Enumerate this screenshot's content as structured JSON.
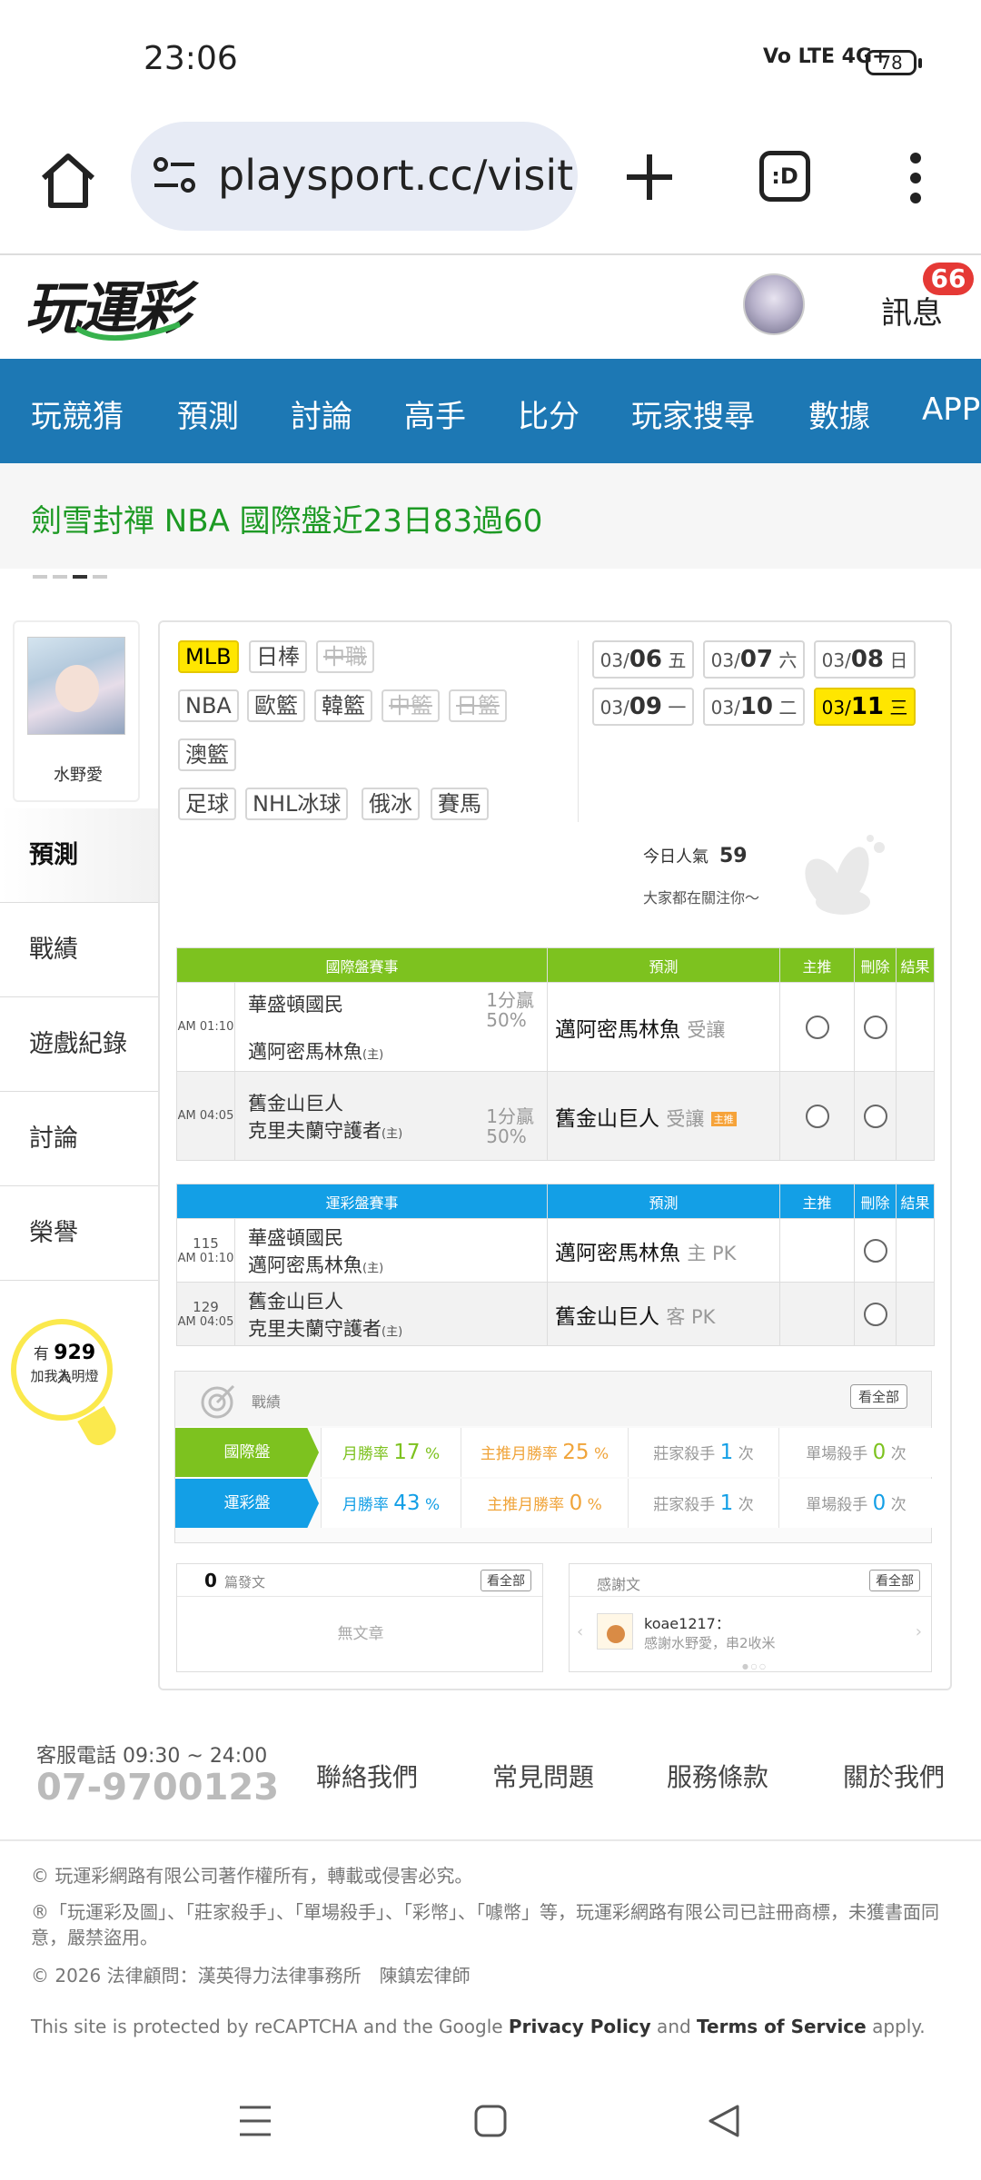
{
  "status_bar": {
    "time": "23:06",
    "network": "Vo LTE 4G+",
    "battery": "78"
  },
  "browser": {
    "url": "playsport.cc/visit",
    "tab_label": ":D"
  },
  "site": {
    "logo": "玩運彩",
    "messages_label": "訊息",
    "messages_count": "66",
    "nav": [
      "玩競猜",
      "預測",
      "討論",
      "高手",
      "比分",
      "玩家搜尋",
      "數據",
      "APP"
    ],
    "promo": "劍雪封禪 NBA 國際盤近23日83過60"
  },
  "profile": {
    "name": "水野愛",
    "menu": [
      "預測",
      "戰績",
      "遊戲紀錄",
      "討論",
      "榮譽"
    ],
    "fans_prefix": "有",
    "fans_count": "929",
    "fans_suffix": "人",
    "fans_cta": "加我為明燈"
  },
  "leagues": {
    "row1": [
      "MLB",
      "日棒",
      "中職"
    ],
    "row2": [
      "NBA",
      "歐籃",
      "韓籃",
      "中籃",
      "日籃"
    ],
    "row3": [
      "澳籃"
    ],
    "row4": [
      "足球",
      "NHL冰球",
      "俄冰",
      "賽馬"
    ]
  },
  "dates": [
    {
      "md": "03/",
      "day": "06",
      "wd": "五"
    },
    {
      "md": "03/",
      "day": "07",
      "wd": "六"
    },
    {
      "md": "03/",
      "day": "08",
      "wd": "日"
    },
    {
      "md": "03/",
      "day": "09",
      "wd": "一"
    },
    {
      "md": "03/",
      "day": "10",
      "wd": "二"
    },
    {
      "md": "03/",
      "day": "11",
      "wd": "三"
    }
  ],
  "popularity": {
    "label": "今日人氣",
    "value": "59",
    "note": "大家都在關注你～"
  },
  "intl_table": {
    "headers": [
      "國際盤賽事",
      "預測",
      "主推",
      "刪除",
      "結果"
    ],
    "rows": [
      {
        "time": "AM 01:10",
        "team1": "華盛頓國民",
        "team2": "邁阿密馬林魚",
        "home": "(主)",
        "odds1": "1分贏",
        "odds2": "50%",
        "pick": "邁阿密馬林魚",
        "pick_type": "受讓"
      },
      {
        "time": "AM 04:05",
        "team1": "舊金山巨人",
        "team2": "克里夫蘭守護者",
        "home": "(主)",
        "odds1": "1分贏",
        "odds2": "50%",
        "pick": "舊金山巨人",
        "pick_type": "受讓",
        "tag": "主推"
      }
    ]
  },
  "lottery_table": {
    "headers": [
      "運彩盤賽事",
      "預測",
      "主推",
      "刪除",
      "結果"
    ],
    "rows": [
      {
        "no": "115",
        "time": "AM 01:10",
        "team1": "華盛頓國民",
        "team2": "邁阿密馬林魚",
        "home": "(主)",
        "pick": "邁阿密馬林魚",
        "pick_type": "主 PK"
      },
      {
        "no": "129",
        "time": "AM 04:05",
        "team1": "舊金山巨人",
        "team2": "克里夫蘭守護者",
        "home": "(主)",
        "pick": "舊金山巨人",
        "pick_type": "客 PK"
      }
    ]
  },
  "record": {
    "title": "戰績",
    "view_all": "看全部",
    "rows": [
      {
        "label": "國際盤",
        "color": "#7dc21f",
        "win_label": "月勝率",
        "win": "17",
        "main_label": "主推月勝率",
        "main": "25",
        "banker_label": "莊家殺手",
        "banker": "1",
        "single_label": "單場殺手",
        "single": "0",
        "pct": "%",
        "times": "次"
      },
      {
        "label": "運彩盤",
        "color": "#139fe6",
        "win_label": "月勝率",
        "win": "43",
        "main_label": "主推月勝率",
        "main": "0",
        "banker_label": "莊家殺手",
        "banker": "1",
        "single_label": "單場殺手",
        "single": "0",
        "pct": "%",
        "times": "次"
      }
    ]
  },
  "posts": {
    "count": "0",
    "label": "篇發文",
    "view_all": "看全部",
    "empty": "無文章"
  },
  "thanks": {
    "title": "感謝文",
    "view_all": "看全部",
    "user": "koae1217：",
    "text": "感謝水野愛，串2收米"
  },
  "footer": {
    "contact_label": "客服電話 09:30 ~ 24:00",
    "phone": "07-9700123",
    "links": [
      "聯絡我們",
      "常見問題",
      "服務條款",
      "關於我們"
    ],
    "copyright": "© 玩運彩網路有限公司著作權所有，轉載或侵害必究。",
    "trademark": "®「玩運彩及圖」、「莊家殺手」、「單場殺手」、「彩幣」、「噱幣」等，玩運彩網路有限公司已註冊商標，未獲書面同意，嚴禁盜用。",
    "legal": "© 2026 法律顧問：漢英得力法律事務所　陳鎮宏律師",
    "recaptcha_pre": "This site is protected by reCAPTCHA and the Google ",
    "privacy": "Privacy Policy",
    "and": " and ",
    "terms": "Terms of Service",
    "apply": " apply."
  }
}
